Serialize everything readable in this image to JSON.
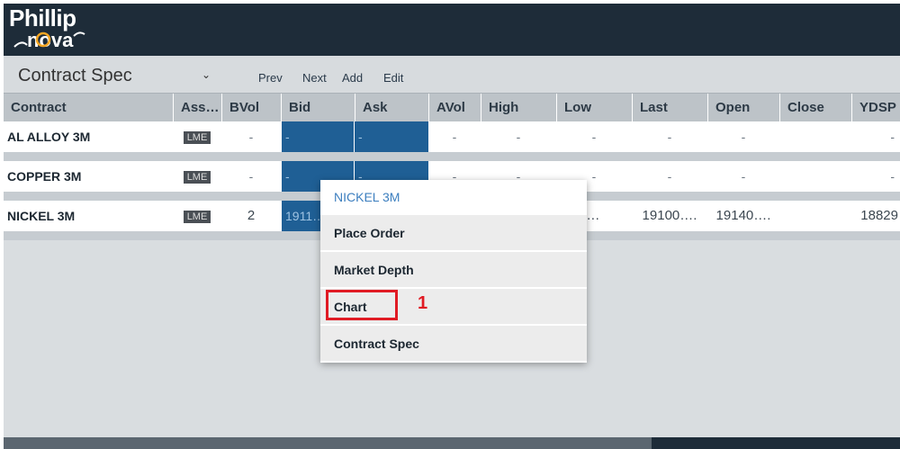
{
  "app": {
    "logo_top": "Phillip",
    "logo_bottom": "nova"
  },
  "toolbar": {
    "title": "Contract Spec",
    "caret": "⌄",
    "prev": "Prev",
    "next": "Next",
    "add": "Add",
    "edit": "Edit"
  },
  "table": {
    "headers": [
      "Contract",
      "Ass…",
      "BVol",
      "Bid",
      "Ask",
      "AVol",
      "High",
      "Low",
      "Last",
      "Open",
      "Close",
      "YDSP"
    ],
    "rows": [
      {
        "name": "AL ALLOY 3M",
        "asset": "LME",
        "bvol": "-",
        "bid": "-",
        "ask": "-",
        "avol": "-",
        "high": "-",
        "low": "-",
        "last": "-",
        "open": "-",
        "close": "",
        "ydsp": "-"
      },
      {
        "name": "COPPER 3M",
        "asset": "LME",
        "bvol": "-",
        "bid": "-",
        "ask": "-",
        "avol": "-",
        "high": "-",
        "low": "-",
        "last": "-",
        "open": "-",
        "close": "",
        "ydsp": "-"
      },
      {
        "name": "NICKEL 3M",
        "asset": "LME",
        "bvol": "2",
        "bid": "1911…",
        "ask": "",
        "avol": "",
        "high": "",
        "low": "10….",
        "last": "19100….",
        "open": "19140….",
        "close": "",
        "ydsp": "18829"
      }
    ]
  },
  "context_menu": {
    "title": "NICKEL 3M",
    "items": [
      "Place Order",
      "Market Depth",
      "Chart",
      "Contract Spec"
    ]
  },
  "annotation": {
    "step": "1",
    "color": "#e01b24"
  },
  "colors": {
    "header_bg": "#1e2c39",
    "bid_bg": "#1f5f95",
    "menu_title": "#3d7fbf"
  }
}
